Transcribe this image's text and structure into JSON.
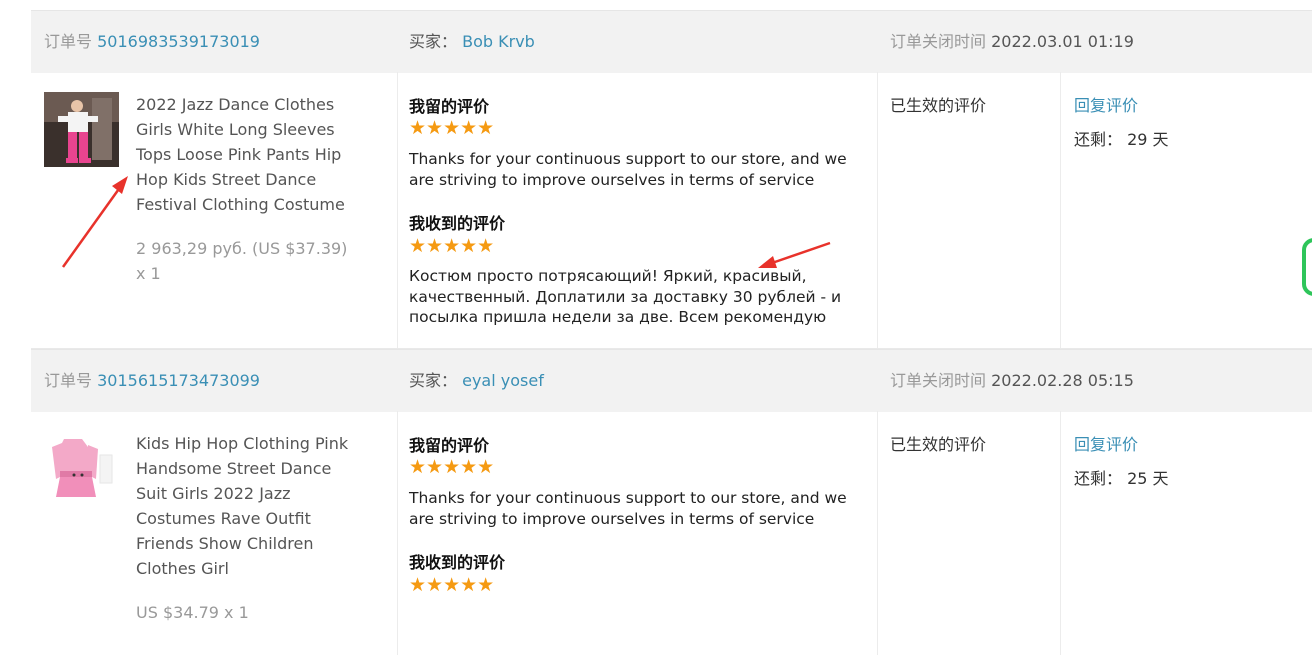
{
  "orders": [
    {
      "order_no_label": "订单号",
      "order_no": "5016983539173019",
      "buyer_label": "买家：",
      "buyer": "Bob Krvb",
      "close_time_label": "订单关闭时间",
      "close_time": "2022.03.01 01:19",
      "product_title": "2022 Jazz Dance Clothes Girls White Long Sleeves Tops Loose Pink Pants Hip Hop Kids Street Dance Festival Clothing Costume",
      "price": "2 963,29 руб. (US $37.39) x 1",
      "my_review_heading": "我留的评价",
      "my_review_stars": 5,
      "my_review_text": "Thanks for your continuous support to our store, and we are striving to improve ourselves in terms of service",
      "received_review_heading": "我收到的评价",
      "received_review_stars": 5,
      "received_review_text": "Костюм просто потрясающий! Яркий, красивый, качественный. Доплатили за доставку 30 рублей - и посылка пришла недели за две. Всем рекомендую",
      "status": "已生效的评价",
      "reply_label": "回复评价",
      "remaining_label": "还剩：",
      "remaining_days": "29 天"
    },
    {
      "order_no_label": "订单号",
      "order_no": "3015615173473099",
      "buyer_label": "买家：",
      "buyer": "eyal yosef",
      "close_time_label": "订单关闭时间",
      "close_time": "2022.02.28 05:15",
      "product_title": "Kids Hip Hop Clothing Pink Handsome Street Dance Suit Girls 2022 Jazz Costumes Rave Outfit Friends Show Children Clothes Girl",
      "price": "US $34.79 x 1",
      "my_review_heading": "我留的评价",
      "my_review_stars": 5,
      "my_review_text": "Thanks for your continuous support to our store, and we are striving to improve ourselves in terms of service",
      "received_review_heading": "我收到的评价",
      "received_review_stars": 5,
      "status": "已生效的评价",
      "reply_label": "回复评价",
      "remaining_label": "还剩：",
      "remaining_days": "25 天"
    }
  ],
  "stars_glyph": "★★★★★",
  "colors": {
    "link": "#3a8fb5",
    "star": "#f59a12",
    "header_bg": "#f2f2f2",
    "annotation_arrow": "#e8322b"
  }
}
